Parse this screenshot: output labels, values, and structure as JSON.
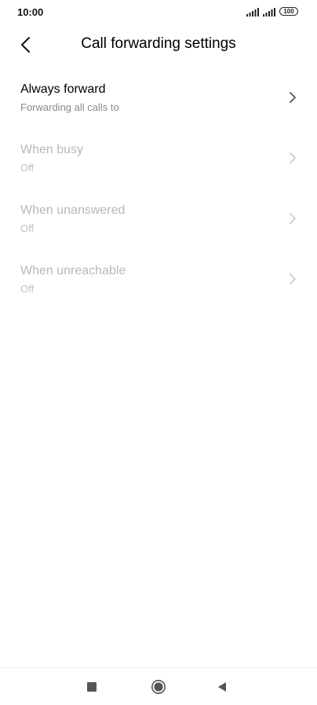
{
  "status_bar": {
    "time": "10:00",
    "battery": "100",
    "icons": [
      "signal-icon",
      "signal-icon",
      "battery-icon"
    ]
  },
  "header": {
    "title": "Call forwarding settings",
    "back_icon": "chevron-left-icon"
  },
  "settings": {
    "items": [
      {
        "title": "Always forward",
        "subtitle": "Forwarding all calls to",
        "enabled": true
      },
      {
        "title": "When busy",
        "subtitle": "Off",
        "enabled": false
      },
      {
        "title": "When unanswered",
        "subtitle": "Off",
        "enabled": false
      },
      {
        "title": "When unreachable",
        "subtitle": "Off",
        "enabled": false
      }
    ]
  },
  "nav_bar": {
    "icons": [
      "square-icon",
      "circle-icon",
      "triangle-left-icon"
    ]
  },
  "colors": {
    "title_text": "#000000",
    "subtitle_text": "#8a8a8a",
    "disabled_text": "#b8b8b8",
    "chevron_enabled": "#555555",
    "chevron_disabled": "#cccccc"
  }
}
